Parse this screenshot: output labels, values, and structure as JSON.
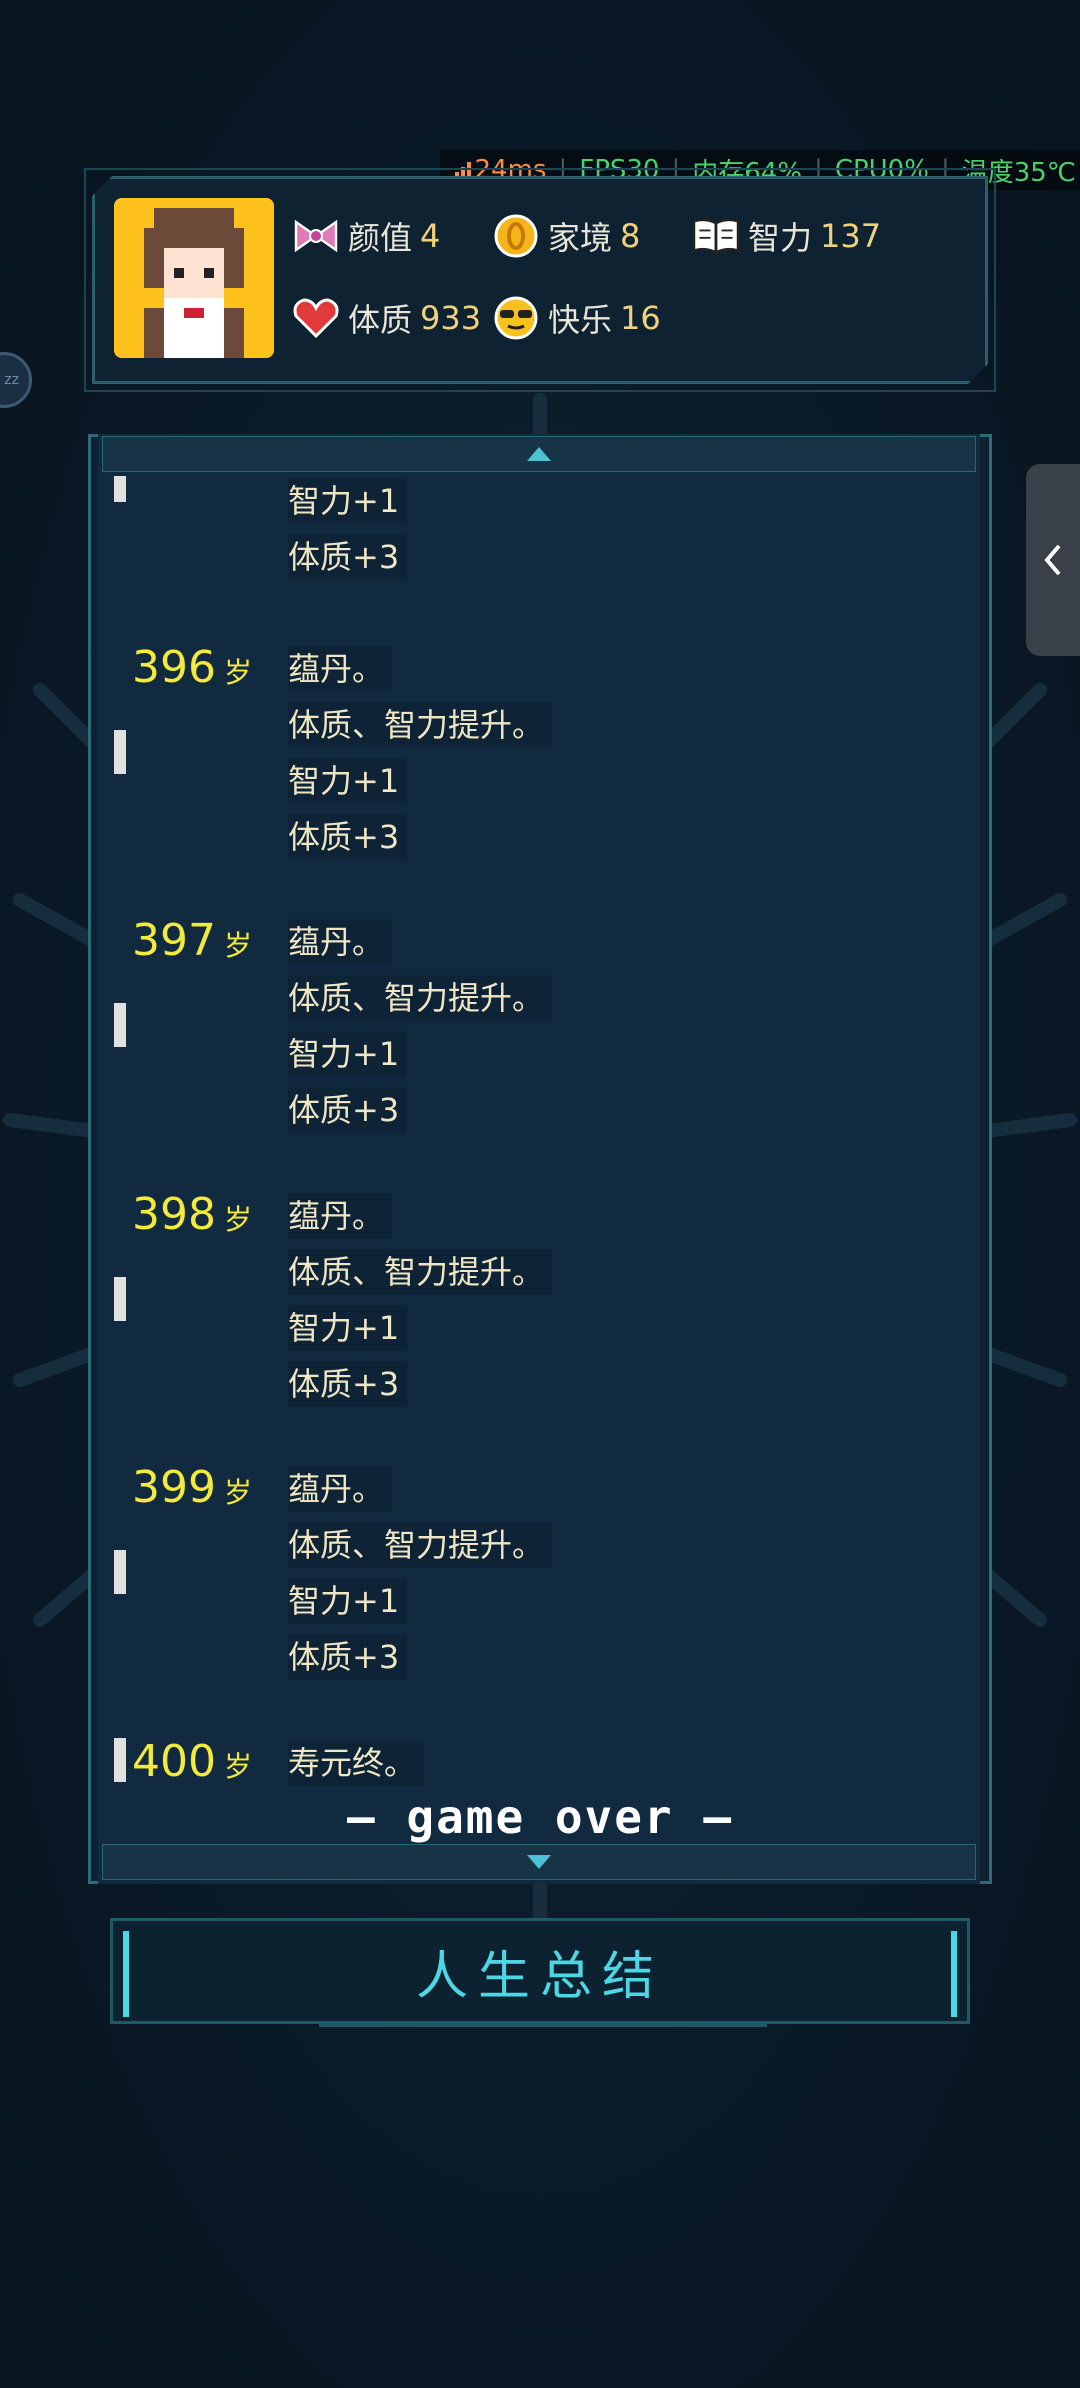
{
  "perf": {
    "ping": "24ms",
    "fps": "FPS30",
    "memory": "内存64%",
    "cpu": "CPU0%",
    "temp": "温度35℃"
  },
  "bubble_text": "zz",
  "attributes": [
    {
      "label": "颜值",
      "value": "4",
      "icon": "ribbon-icon"
    },
    {
      "label": "家境",
      "value": "8",
      "icon": "coin-icon"
    },
    {
      "label": "智力",
      "value": "137",
      "icon": "book-icon"
    },
    {
      "label": "体质",
      "value": "933",
      "icon": "heart-icon"
    },
    {
      "label": "快乐",
      "value": "16",
      "icon": "sunglasses-face-icon"
    }
  ],
  "log": {
    "age_unit": "岁",
    "top_partial": [
      "智力+1",
      "体质+3"
    ],
    "entries": [
      {
        "age": "396",
        "lines": [
          "蕴丹。",
          "体质、智力提升。",
          "智力+1",
          "体质+3"
        ]
      },
      {
        "age": "397",
        "lines": [
          "蕴丹。",
          "体质、智力提升。",
          "智力+1",
          "体质+3"
        ]
      },
      {
        "age": "398",
        "lines": [
          "蕴丹。",
          "体质、智力提升。",
          "智力+1",
          "体质+3"
        ]
      },
      {
        "age": "399",
        "lines": [
          "蕴丹。",
          "体质、智力提升。",
          "智力+1",
          "体质+3"
        ]
      },
      {
        "age": "400",
        "lines": [
          "寿元终。"
        ]
      }
    ],
    "game_over": "— game over —"
  },
  "summary_button": "人生总结",
  "colors": {
    "accent": "#4dd6e3",
    "age": "#f4ea3a",
    "value": "#f1d27a"
  }
}
